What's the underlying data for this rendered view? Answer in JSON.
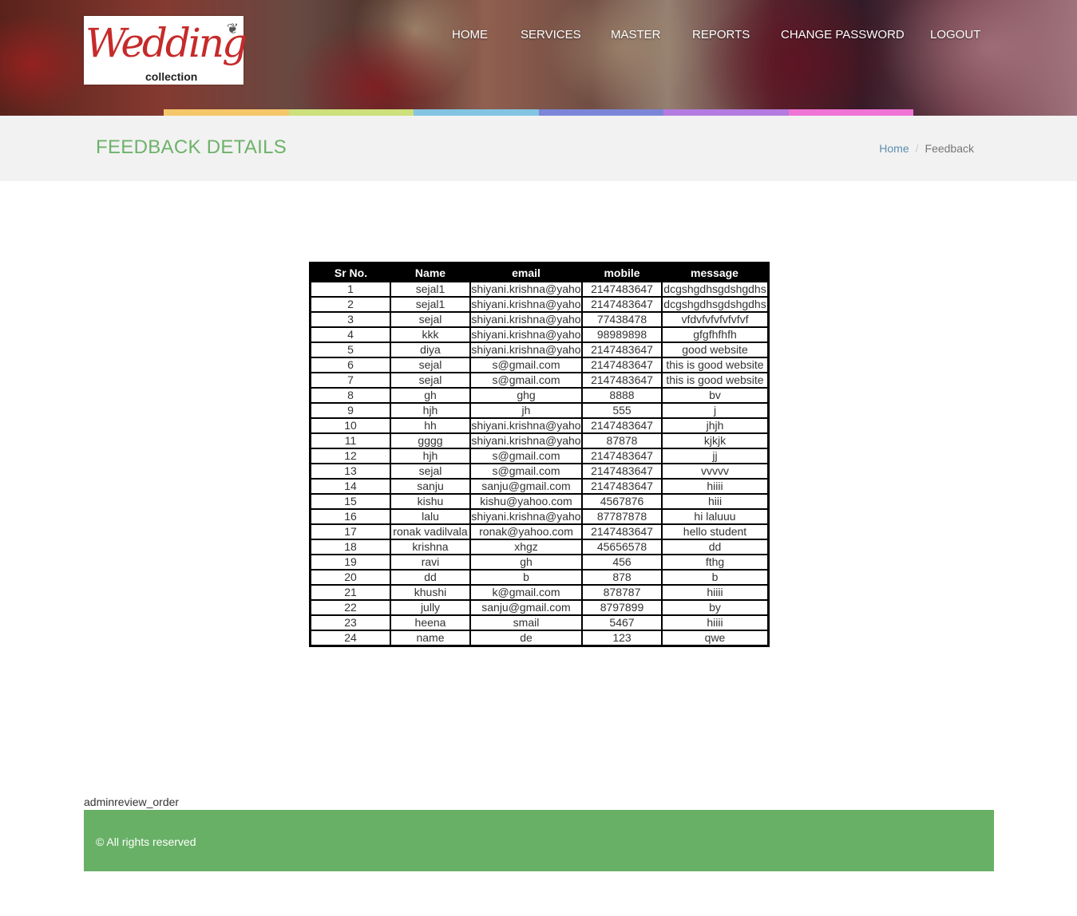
{
  "header": {
    "logo_text": "Wedding",
    "logo_subtext": "collection",
    "nav": [
      {
        "label": "HOME"
      },
      {
        "label": "SERVICES"
      },
      {
        "label": "MASTER"
      },
      {
        "label": "REPORTS"
      },
      {
        "label": "CHANGE PASSWORD"
      },
      {
        "label": "LOGOUT"
      }
    ],
    "strip_colors": [
      "#f5c76a",
      "#cde07b",
      "#82c4e2",
      "#7b86d8",
      "#b47be0",
      "#ef74d6"
    ]
  },
  "page": {
    "title": "FEEDBACK DETAILS",
    "breadcrumb_home": "Home",
    "breadcrumb_current": "Feedback",
    "title_color": "#6db26a"
  },
  "table": {
    "columns": [
      "Sr No.",
      "Name",
      "email",
      "mobile",
      "message"
    ],
    "rows": [
      [
        "1",
        "sejal1",
        "shiyani.krishna@yaho",
        "2147483647",
        "dcgshgdhsgdshgdhs"
      ],
      [
        "2",
        "sejal1",
        "shiyani.krishna@yaho",
        "2147483647",
        "dcgshgdhsgdshgdhs"
      ],
      [
        "3",
        "sejal",
        "shiyani.krishna@yaho",
        "77438478",
        "vfdvfvfvfvfvfvf"
      ],
      [
        "4",
        "kkk",
        "shiyani.krishna@yaho",
        "98989898",
        "gfgfhfhfh"
      ],
      [
        "5",
        "diya",
        "shiyani.krishna@yaho",
        "2147483647",
        "good website"
      ],
      [
        "6",
        "sejal",
        "s@gmail.com",
        "2147483647",
        "this is good website"
      ],
      [
        "7",
        "sejal",
        "s@gmail.com",
        "2147483647",
        "this is good website"
      ],
      [
        "8",
        "gh",
        "ghg",
        "8888",
        "bv"
      ],
      [
        "9",
        "hjh",
        "jh",
        "555",
        "j"
      ],
      [
        "10",
        "hh",
        "shiyani.krishna@yaho",
        "2147483647",
        "jhjh"
      ],
      [
        "11",
        "gggg",
        "shiyani.krishna@yaho",
        "87878",
        "kjkjk"
      ],
      [
        "12",
        "hjh",
        "s@gmail.com",
        "2147483647",
        "jj"
      ],
      [
        "13",
        "sejal",
        "s@gmail.com",
        "2147483647",
        "vvvvv"
      ],
      [
        "14",
        "sanju",
        "sanju@gmail.com",
        "2147483647",
        "hiiii"
      ],
      [
        "15",
        "kishu",
        "kishu@yahoo.com",
        "4567876",
        "hiii"
      ],
      [
        "16",
        "lalu",
        "shiyani.krishna@yaho",
        "87787878",
        "hi laluuu"
      ],
      [
        "17",
        "ronak vadilvala",
        "ronak@yahoo.com",
        "2147483647",
        "hello student"
      ],
      [
        "18",
        "krishna",
        "xhgz",
        "45656578",
        "dd"
      ],
      [
        "19",
        "ravi",
        "gh",
        "456",
        "fthg"
      ],
      [
        "20",
        "dd",
        "b",
        "878",
        "b"
      ],
      [
        "21",
        "khushi",
        "k@gmail.com",
        "878787",
        "hiiii"
      ],
      [
        "22",
        "jully",
        "sanju@gmail.com",
        "8797899",
        "by"
      ],
      [
        "23",
        "heena",
        "smail",
        "5467",
        "hiiii"
      ],
      [
        "24",
        "name",
        "de",
        "123",
        "qwe"
      ]
    ]
  },
  "footer": {
    "page_id": "adminreview_order",
    "copyright": "© All rights reserved",
    "color": "#68b066"
  }
}
